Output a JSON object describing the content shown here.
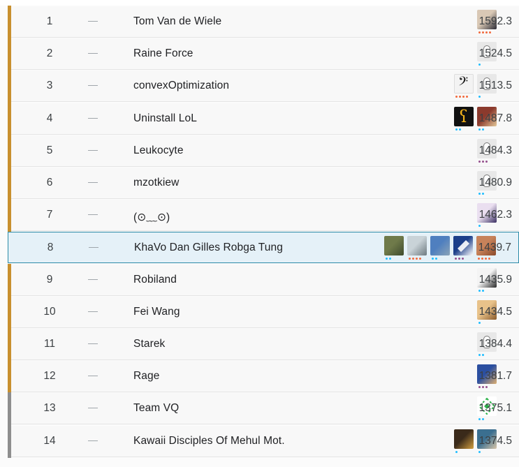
{
  "leaderboard": {
    "rows": [
      {
        "rank": "1",
        "delta": "—",
        "team": "Tom Van de Wiele",
        "score": "1592.3",
        "tier": "gold",
        "avatars": [
          {
            "icon": "person-photo-icon",
            "colors": [
              "#d9c8b5",
              "#2a2a35"
            ],
            "dots": {
              "count": 4,
              "color": "#f26a3d"
            }
          }
        ]
      },
      {
        "rank": "2",
        "delta": "—",
        "team": "Raine Force",
        "score": "1524.5",
        "tier": "gold",
        "avatars": [
          {
            "icon": "goose-placeholder-icon",
            "colors": [
              "#e8e8e8",
              "#777777"
            ],
            "dots": {
              "count": 1,
              "color": "#20beff"
            }
          }
        ]
      },
      {
        "rank": "3",
        "delta": "—",
        "team": "convexOptimization",
        "score": "1513.5",
        "tier": "gold",
        "avatars": [
          {
            "icon": "bass-clef-icon",
            "colors": [
              "#f3f3f3",
              "#1a1a1a"
            ],
            "dots": {
              "count": 4,
              "color": "#f26a3d"
            }
          },
          {
            "icon": "goose-placeholder-icon",
            "colors": [
              "#e8e8e8",
              "#777777"
            ],
            "dots": {
              "count": 1,
              "color": "#20beff"
            }
          }
        ]
      },
      {
        "rank": "4",
        "delta": "—",
        "team": "Uninstall LoL",
        "score": "1487.8",
        "tier": "gold",
        "avatars": [
          {
            "icon": "snake-glyph-icon",
            "colors": [
              "#111111",
              "#f2b21b"
            ],
            "dots": {
              "count": 2,
              "color": "#20beff"
            }
          },
          {
            "icon": "person-photo-icon",
            "colors": [
              "#8b3a2d",
              "#e3c89a"
            ],
            "dots": {
              "count": 2,
              "color": "#20beff"
            }
          }
        ]
      },
      {
        "rank": "5",
        "delta": "—",
        "team": "Leukocyte",
        "score": "1484.3",
        "tier": "gold",
        "avatars": [
          {
            "icon": "goose-placeholder-icon",
            "colors": [
              "#e8e8e8",
              "#777777"
            ],
            "dots": {
              "count": 3,
              "color": "#96508e"
            }
          }
        ]
      },
      {
        "rank": "6",
        "delta": "—",
        "team": "mzotkiew",
        "score": "1480.9",
        "tier": "gold",
        "avatars": [
          {
            "icon": "goose-placeholder-icon",
            "colors": [
              "#e8e8e8",
              "#777777"
            ],
            "dots": {
              "count": 2,
              "color": "#20beff"
            }
          }
        ]
      },
      {
        "rank": "7",
        "delta": "—",
        "team": "(⊙﹏⊙)",
        "score": "1462.3",
        "tier": "gold",
        "avatars": [
          {
            "icon": "anime-avatar-icon",
            "colors": [
              "#eadff0",
              "#3b2f63"
            ],
            "dots": {
              "count": 1,
              "color": "#20beff"
            }
          }
        ]
      },
      {
        "rank": "8",
        "delta": "—",
        "team": "KhaVo Dan Gilles Robga Tung",
        "score": "1439.7",
        "tier": "gold",
        "highlight": true,
        "avatars": [
          {
            "icon": "landscape-photo-icon",
            "colors": [
              "#6f7a4a",
              "#3e4a2c"
            ],
            "dots": {
              "count": 2,
              "color": "#20beff"
            }
          },
          {
            "icon": "person-photo-icon",
            "colors": [
              "#c9d3d8",
              "#6e7a80"
            ],
            "dots": {
              "count": 4,
              "color": "#f26a3d"
            }
          },
          {
            "icon": "coast-photo-icon",
            "colors": [
              "#4f7fbf",
              "#8aa3b8"
            ],
            "dots": {
              "count": 2,
              "color": "#20beff"
            }
          },
          {
            "icon": "book-logo-icon",
            "colors": [
              "#1c3f8a",
              "#ffffff"
            ],
            "dots": {
              "count": 3,
              "color": "#96508e"
            }
          },
          {
            "icon": "desert-photo-icon",
            "colors": [
              "#c7825a",
              "#8a4a2b"
            ],
            "dots": {
              "count": 4,
              "color": "#f26a3d"
            }
          }
        ]
      },
      {
        "rank": "9",
        "delta": "—",
        "team": "Robiland",
        "score": "1435.9",
        "tier": "gold",
        "avatars": [
          {
            "icon": "person-photo-icon",
            "colors": [
              "#f4f4f4",
              "#2a2a2a"
            ],
            "dots": {
              "count": 2,
              "color": "#20beff"
            }
          }
        ]
      },
      {
        "rank": "10",
        "delta": "—",
        "team": "Fei Wang",
        "score": "1434.5",
        "tier": "gold",
        "avatars": [
          {
            "icon": "person-photo-icon",
            "colors": [
              "#e8c28a",
              "#8a5a2a"
            ],
            "dots": {
              "count": 1,
              "color": "#20beff"
            }
          }
        ]
      },
      {
        "rank": "11",
        "delta": "—",
        "team": "Starek",
        "score": "1384.4",
        "tier": "gold",
        "avatars": [
          {
            "icon": "goose-placeholder-icon",
            "colors": [
              "#e8e8e8",
              "#777777"
            ],
            "dots": {
              "count": 2,
              "color": "#20beff"
            }
          }
        ]
      },
      {
        "rank": "12",
        "delta": "—",
        "team": "Rage",
        "score": "1381.7",
        "tier": "gold",
        "avatars": [
          {
            "icon": "hero-avatar-icon",
            "colors": [
              "#2b4fa0",
              "#e0b070"
            ],
            "dots": {
              "count": 3,
              "color": "#96508e"
            }
          }
        ]
      },
      {
        "rank": "13",
        "delta": "—",
        "team": "Team VQ",
        "score": "1375.1",
        "tier": "silver",
        "avatars": [
          {
            "icon": "diamond-logo-icon",
            "colors": [
              "#ffffff",
              "#2db34a"
            ],
            "dots": {
              "count": 2,
              "color": "#20beff"
            }
          }
        ]
      },
      {
        "rank": "14",
        "delta": "—",
        "team": "Kawaii Disciples Of Mehul Mot.",
        "score": "1374.5",
        "tier": "silver",
        "avatars": [
          {
            "icon": "anime-avatar-icon",
            "colors": [
              "#3a2a1a",
              "#d4a040"
            ],
            "dots": {
              "count": 1,
              "color": "#20beff"
            }
          },
          {
            "icon": "person-photo-icon",
            "colors": [
              "#3b6f90",
              "#d8c5a8"
            ],
            "dots": {
              "count": 1,
              "color": "#20beff"
            }
          }
        ]
      }
    ],
    "tier_colors": {
      "gold": "#c8902f",
      "silver": "#8e8e8e"
    }
  }
}
